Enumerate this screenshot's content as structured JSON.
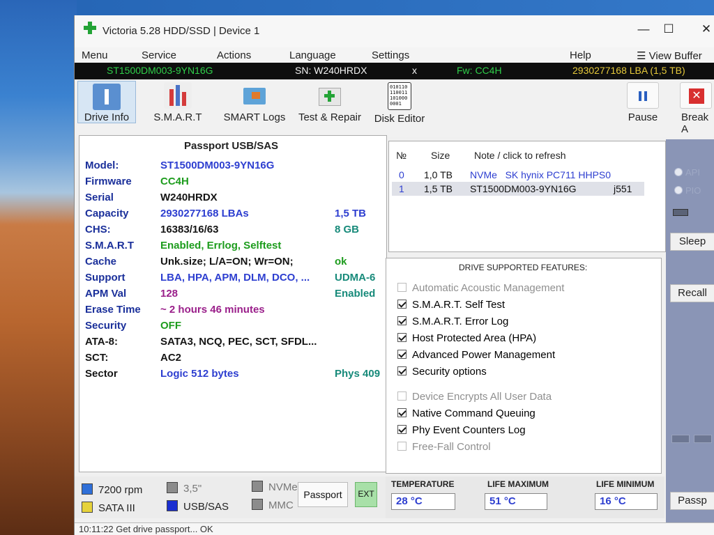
{
  "window": {
    "title": "Victoria 5.28 HDD/SSD | Device 1",
    "controls": {
      "minimize": "—",
      "maximize": "☐",
      "close": "✕"
    }
  },
  "menu": [
    "Menu",
    "Service",
    "Actions",
    "Language",
    "Settings",
    "Help"
  ],
  "view_buffer": "View Buffer Liv",
  "drive_bar": {
    "model": "ST1500DM003-9YN16G",
    "serial": "SN: W240HRDX",
    "close": "x",
    "firmware": "Fw: CC4H",
    "lba": "2930277168 LBA (1,5 TB)"
  },
  "toolbar": {
    "drive_info": "Drive Info",
    "smart": "S.M.A.R.T",
    "smart_logs": "SMART Logs",
    "test_repair": "Test & Repair",
    "disk_editor": "Disk Editor",
    "pause": "Pause",
    "break": "Break A"
  },
  "passport": {
    "header": "Passport USB/SAS",
    "rows": [
      {
        "label": "Model:",
        "value": "ST1500DM003-9YN16G",
        "extra": ""
      },
      {
        "label": "Firmware",
        "value": "CC4H",
        "extra": ""
      },
      {
        "label": "Serial",
        "value": "W240HRDX",
        "extra": ""
      },
      {
        "label": "Capacity",
        "value": "2930277168 LBAs",
        "extra": "1,5 TB"
      },
      {
        "label": "CHS:",
        "value": "16383/16/63",
        "extra": "8 GB"
      },
      {
        "label": "S.M.A.R.T",
        "value": "Enabled, Errlog, Selftest",
        "extra": ""
      },
      {
        "label": "Cache",
        "value": "Unk.size; L/A=ON; Wr=ON;",
        "extra": "ok"
      },
      {
        "label": "Support",
        "value": "LBA, HPA, APM, DLM, DCO, ...",
        "extra": "UDMA-6"
      },
      {
        "label": "APM Val",
        "value": "128",
        "extra": "Enabled"
      },
      {
        "label": "Erase Time",
        "value": "~ 2 hours 46 minutes",
        "extra": ""
      },
      {
        "label": "Security",
        "value": "OFF",
        "extra": ""
      },
      {
        "label": "ATA-8:",
        "value": "SATA3, NCQ, PEC, SCT, SFDL...",
        "extra": ""
      },
      {
        "label": "SCT:",
        "value": "AC2",
        "extra": ""
      },
      {
        "label": "Sector",
        "value": "Logic 512 bytes",
        "extra": "Phys 409"
      }
    ]
  },
  "drives": {
    "headers": {
      "no": "№",
      "size": "Size",
      "note": "Note / click to refresh"
    },
    "rows": [
      {
        "no": "0",
        "size": "1,0 TB",
        "note": "NVMe   SK hynix PC711 HHPS0",
        "tag": ""
      },
      {
        "no": "1",
        "size": "1,5 TB",
        "note": "ST1500DM003-9YN16G",
        "tag": "j551"
      }
    ]
  },
  "features": {
    "title": "DRIVE SUPPORTED FEATURES:",
    "items": [
      {
        "label": "Automatic Acoustic Management",
        "checked": false,
        "enabled": false
      },
      {
        "label": "S.M.A.R.T. Self Test",
        "checked": true,
        "enabled": true
      },
      {
        "label": "S.M.A.R.T. Error Log",
        "checked": true,
        "enabled": true
      },
      {
        "label": "Host Protected Area (HPA)",
        "checked": true,
        "enabled": true
      },
      {
        "label": "Advanced Power Management",
        "checked": true,
        "enabled": true
      },
      {
        "label": "Security options",
        "checked": true,
        "enabled": true
      },
      {
        "label": "Device Encrypts All User Data",
        "checked": false,
        "enabled": false
      },
      {
        "label": "Native Command Queuing",
        "checked": true,
        "enabled": true
      },
      {
        "label": "Phy Event Counters Log",
        "checked": true,
        "enabled": true
      },
      {
        "label": "Free-Fall Control",
        "checked": false,
        "enabled": false
      }
    ]
  },
  "status": {
    "rpm": "7200 rpm",
    "form": "3,5\"",
    "nvme": "NVMe",
    "sata": "SATA III",
    "usb": "USB/SAS",
    "mmc": "MMC",
    "passport_btn": "Passport",
    "ext_btn": "EXT"
  },
  "temps": {
    "temperature_label": "TEMPERATURE",
    "temperature": "28 °C",
    "life_max_label": "LIFE MAXIMUM",
    "life_max": "51 °C",
    "life_min_label": "LIFE MINIMUM",
    "life_min": "16 °C"
  },
  "right": {
    "api": "API",
    "pio": "PIO",
    "sleep": "Sleep",
    "recall": "Recall",
    "passp": "Passp"
  },
  "log": "10:11:22   Get drive passport... OK",
  "colors": {
    "accent_green": "#23a336",
    "label_blue": "#1a2f9a",
    "value_blue": "#2d3ed0"
  }
}
